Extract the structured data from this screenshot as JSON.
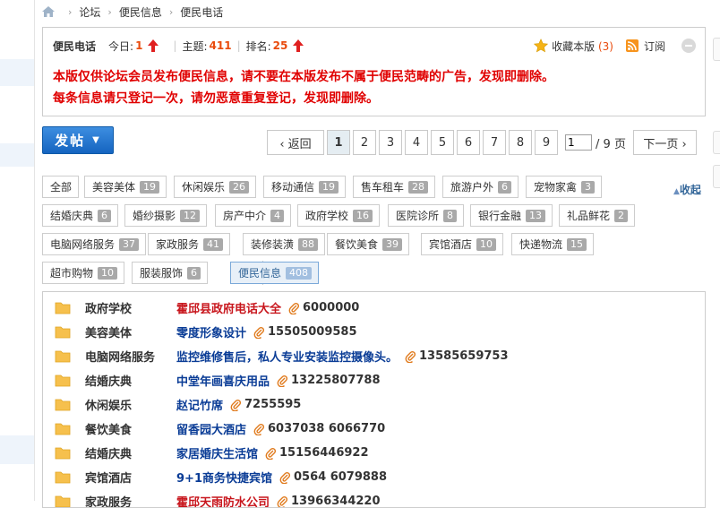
{
  "breadcrumb": {
    "items": [
      "论坛",
      "便民信息",
      "便民电话"
    ]
  },
  "forum": {
    "name": "便民电话",
    "today_label": "今日:",
    "today": "1",
    "topics_label": "主题:",
    "topics": "411",
    "rank_label": "排名:",
    "rank": "25",
    "fav_label": "收藏本版",
    "fav_count": "(3)",
    "subscribe_label": "订阅",
    "notices": [
      "本版仅供论坛会员发布便民信息，请不要在本版发布不属于便民范畴的广告，发现即删除。",
      "每条信息请只登记一次，请勿恶意重复登记，发现即删除。"
    ]
  },
  "post_button": {
    "label": "发帖",
    "caret": "▼"
  },
  "pager": {
    "prev": "‹ 返回",
    "pages": [
      "1",
      "2",
      "3",
      "4",
      "5",
      "6",
      "7",
      "8",
      "9"
    ],
    "current": "1",
    "input_value": "1",
    "total": "/ 9 页",
    "next": "下一页 ›"
  },
  "collapse_label": "收起",
  "tags": [
    {
      "label": "全部",
      "count": null
    },
    {
      "label": "美容美体",
      "count": "19"
    },
    {
      "label": "休闲娱乐",
      "count": "26"
    },
    {
      "label": "移动通信",
      "count": "19"
    },
    {
      "label": "售车租车",
      "count": "28"
    },
    {
      "label": "旅游户外",
      "count": "6"
    },
    {
      "label": "宠物家禽",
      "count": "3"
    },
    {
      "label": "结婚庆典",
      "count": "6"
    },
    {
      "label": "婚纱摄影",
      "count": "12"
    },
    {
      "label": "房产中介",
      "count": "4"
    },
    {
      "label": "政府学校",
      "count": "16"
    },
    {
      "label": "医院诊所",
      "count": "8"
    },
    {
      "label": "银行金融",
      "count": "13"
    },
    {
      "label": "礼品鲜花",
      "count": "2"
    },
    {
      "label": "电脑网络服务",
      "count": "37"
    },
    {
      "label": "家政服务",
      "count": "41"
    },
    {
      "label": "装修装潢",
      "count": "88"
    },
    {
      "label": "餐饮美食",
      "count": "39"
    },
    {
      "label": "宾馆酒店",
      "count": "10"
    },
    {
      "label": "快递物流",
      "count": "15"
    },
    {
      "label": "超市购物",
      "count": "10"
    },
    {
      "label": "服装服饰",
      "count": "6"
    },
    {
      "label": "便民信息",
      "count": "408"
    }
  ],
  "threads": [
    {
      "category": "政府学校",
      "title": "霍邱县政府电话大全",
      "phone": "6000000",
      "red": true
    },
    {
      "category": "美容美体",
      "title": "零度形象设计",
      "phone": "15505009585",
      "red": false
    },
    {
      "category": "电脑网络服务",
      "title": "监控维修售后，私人专业安装监控摄像头。",
      "phone": "13585659753",
      "red": false
    },
    {
      "category": "结婚庆典",
      "title": "中堂年画喜庆用品",
      "phone": "13225807788",
      "red": false
    },
    {
      "category": "休闲娱乐",
      "title": "赵记竹席",
      "phone": "7255595",
      "red": false
    },
    {
      "category": "餐饮美食",
      "title": "留香园大酒店",
      "phone": "6037038 6066770",
      "red": false
    },
    {
      "category": "结婚庆典",
      "title": "家居婚庆生活馆",
      "phone": "15156446922",
      "red": false
    },
    {
      "category": "宾馆酒店",
      "title": "9+1商务快捷宾馆",
      "phone": "0564 6079888",
      "red": false
    },
    {
      "category": "家政服务",
      "title": "霍邱天雨防水公司",
      "phone": "13966344220",
      "red": false
    }
  ]
}
